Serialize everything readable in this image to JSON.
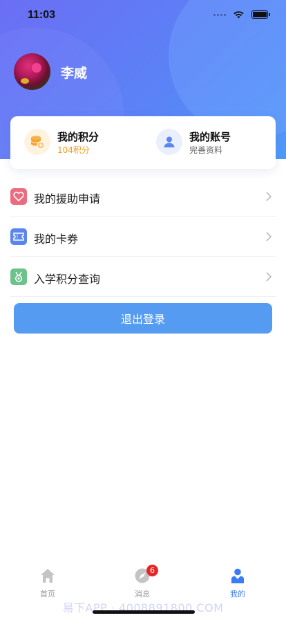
{
  "status_bar": {
    "time": "11:03"
  },
  "profile": {
    "name": "李威"
  },
  "card": {
    "points": {
      "title": "我的积分",
      "value": "104积分"
    },
    "account": {
      "title": "我的账号",
      "sub": "完善资料"
    }
  },
  "menu": {
    "items": [
      {
        "label": "我的援助申请",
        "icon": "heart-icon"
      },
      {
        "label": "我的卡券",
        "icon": "ticket-icon"
      },
      {
        "label": "入学积分查询",
        "icon": "medal-icon"
      }
    ]
  },
  "logout": {
    "label": "退出登录"
  },
  "tabbar": {
    "home": "首页",
    "messages": "消息",
    "messages_badge": "6",
    "mine": "我的"
  },
  "watermark": "易下APP · 4008891800.COM",
  "colors": {
    "accent": "#559bf1",
    "active_tab": "#3a7cf5",
    "points": "#f59a1f",
    "badge": "#e82525"
  }
}
